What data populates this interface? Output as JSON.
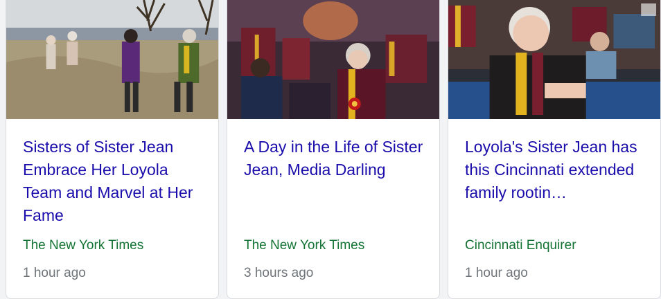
{
  "cards": [
    {
      "headline": "Sisters of Sister Jean Embrace Her Loyola Team and Marvel at Her Fame",
      "source": "The New York Times",
      "time": "1 hour ago",
      "image": "photo-sisters-walking-field"
    },
    {
      "headline": "A Day in the Life of Sister Jean, Media Darling",
      "source": "The New York Times",
      "time": "3 hours ago",
      "image": "photo-sister-jean-crowd"
    },
    {
      "headline": "Loyola's Sister Jean has this Cincinnati extended family rootin…",
      "source": "Cincinnati Enquirer",
      "time": "1 hour ago",
      "image": "photo-sister-jean-courtside"
    }
  ],
  "colors": {
    "headline": "#1a0dab",
    "source": "#137333",
    "time": "#70757a",
    "card_border": "#dadce0",
    "page_bg": "#f1f3f4"
  }
}
